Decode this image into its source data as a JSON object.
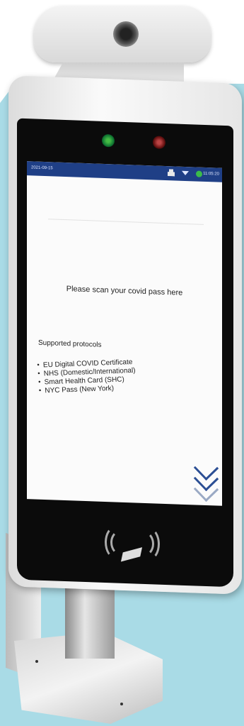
{
  "status_bar": {
    "date": "2021-09-15",
    "time": "11:05:20",
    "icons": [
      "usb-icon",
      "wifi-icon",
      "shield-icon"
    ]
  },
  "screen": {
    "prompt": "Please scan your covid pass here",
    "protocols_title": "Supported protocols",
    "protocols": [
      "EU Digital COVID Certificate",
      "NHS (Domestic/International)",
      "Smart Health Card (SHC)",
      "NYC Pass (New York)"
    ]
  },
  "colors": {
    "status_bar": "#1f3f86",
    "chevron": "#2b4e94",
    "background_panel": "#a9dbe6",
    "sensor_green": "#2f9a3b",
    "sensor_red": "#b03a3a"
  }
}
